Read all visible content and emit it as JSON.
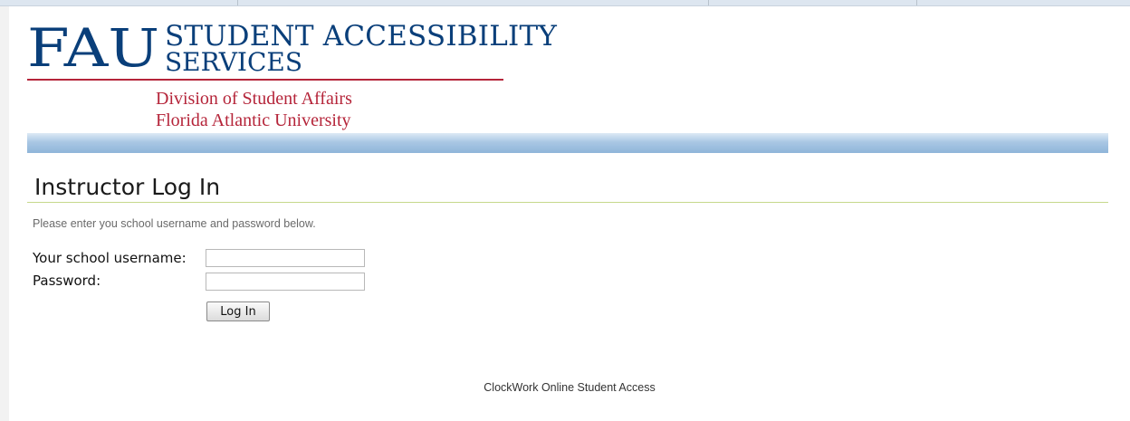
{
  "header": {
    "logo_mark": "FAU",
    "title_line1": "STUDENT ACCESSIBILITY",
    "title_line2": "SERVICES",
    "division": "Division of Student Affairs",
    "university": "Florida Atlantic University",
    "colors": {
      "brand_blue": "#0a3f7a",
      "brand_red": "#b5253a"
    }
  },
  "main": {
    "title": "Instructor Log In",
    "instructions": "Please enter you school username and password below.",
    "form": {
      "username_label": "Your school username:",
      "username_value": "",
      "password_label": "Password:",
      "password_value": "",
      "submit_label": "Log In"
    }
  },
  "footer": {
    "text": "ClockWork Online Student Access"
  }
}
